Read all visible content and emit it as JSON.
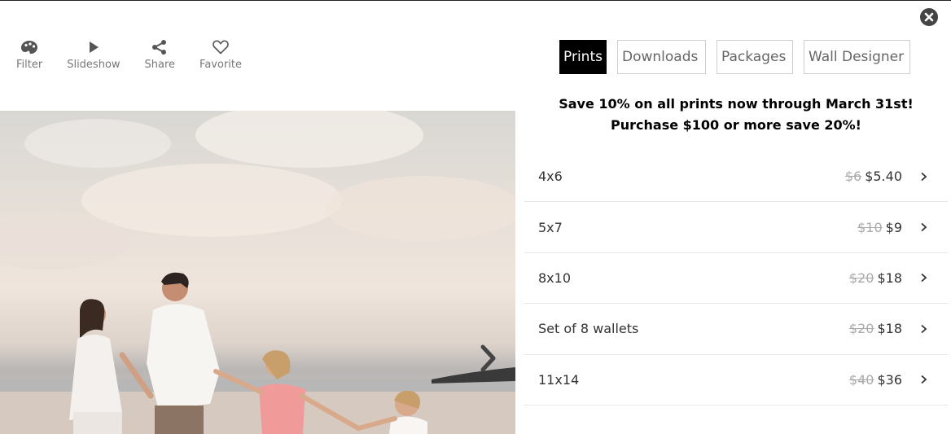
{
  "toolbar": {
    "items": [
      {
        "label": "Filter",
        "icon": "palette-icon"
      },
      {
        "label": "Slideshow",
        "icon": "play-icon"
      },
      {
        "label": "Share",
        "icon": "share-icon"
      },
      {
        "label": "Favorite",
        "icon": "heart-icon"
      }
    ]
  },
  "tabs": [
    {
      "label": "Prints",
      "active": true
    },
    {
      "label": "Downloads",
      "active": false
    },
    {
      "label": "Packages",
      "active": false
    },
    {
      "label": "Wall Designer",
      "active": false
    }
  ],
  "promo": {
    "line1": "Save 10% on all prints now through March 31st!",
    "line2": "Purchase $100 or more save 20%!"
  },
  "products": [
    {
      "name": "4x6",
      "old_price": "$6",
      "price": "$5.40"
    },
    {
      "name": "5x7",
      "old_price": "$10",
      "price": "$9"
    },
    {
      "name": "8x10",
      "old_price": "$20",
      "price": "$18"
    },
    {
      "name": "Set of 8 wallets",
      "old_price": "$20",
      "price": "$18"
    },
    {
      "name": "11x14",
      "old_price": "$40",
      "price": "$36"
    }
  ],
  "colors": {
    "active_tab_bg": "#000000",
    "muted_text": "#aaaaaa",
    "border": "#cfcfcf"
  }
}
